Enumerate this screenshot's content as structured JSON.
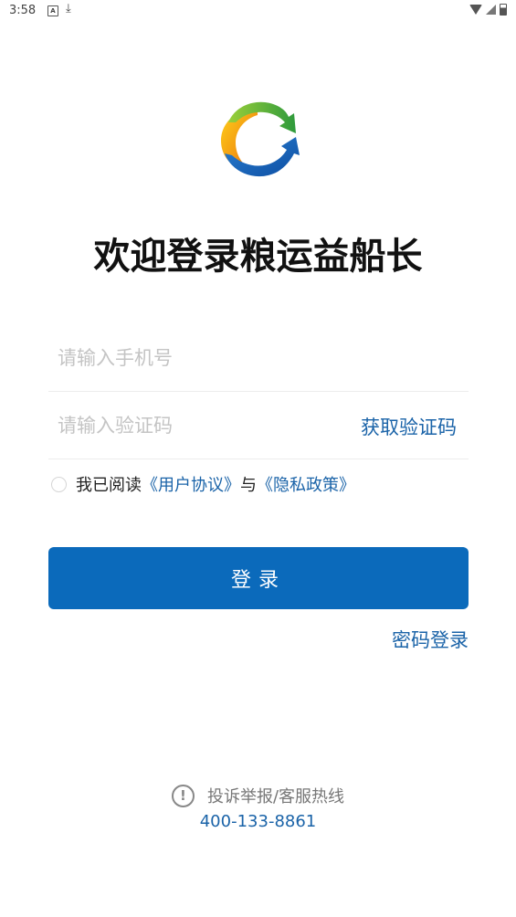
{
  "status_bar": {
    "time": "3:58",
    "icons": [
      "app-notification-icon",
      "download-icon",
      "wifi-icon",
      "signal-icon",
      "battery-icon"
    ]
  },
  "welcome": {
    "title": "欢迎登录粮运益船长"
  },
  "form": {
    "phone_placeholder": "请输入手机号",
    "code_placeholder": "请输入验证码",
    "get_code_label": "获取验证码"
  },
  "agreement": {
    "prefix": "我已阅读",
    "user_agreement": "《用户协议》",
    "conjunction": "与",
    "privacy_policy": "《隐私政策》"
  },
  "login_button_label": "登录",
  "password_login_label": "密码登录",
  "footer": {
    "complaint_label": "投诉举报/客服热线",
    "hotline": "400-133-8861"
  },
  "colors": {
    "primary": "#0b6abb",
    "link": "#1a63a8",
    "placeholder": "#c4c4c4"
  }
}
